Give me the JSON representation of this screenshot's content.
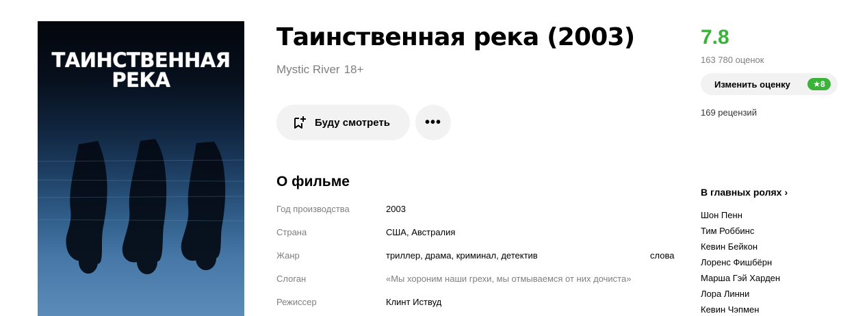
{
  "poster": {
    "title_line1": "ТАИНСТВЕННАЯ",
    "title_line2": "РЕКА"
  },
  "movie": {
    "title": "Таинственная река (2003)",
    "original_title": "Mystic River",
    "age_rating": "18+"
  },
  "actions": {
    "watch_later_label": "Буду смотреть",
    "more_label": "•••"
  },
  "about": {
    "heading": "О фильме",
    "rows": [
      {
        "label": "Год производства",
        "value": "2003"
      },
      {
        "label": "Страна",
        "value": "США, Австралия"
      },
      {
        "label": "Жанр",
        "value": "триллер, драма, криминал, детектив",
        "extra": "слова"
      },
      {
        "label": "Слоган",
        "value": "«Мы хороним наши грехи, мы отмываемся от них дочиста»"
      },
      {
        "label": "Режиссер",
        "value": "Клинт Иствуд"
      }
    ]
  },
  "rating": {
    "score": "7.8",
    "votes": "163 780 оценок",
    "change_label": "Изменить оценку",
    "my_score": "★8",
    "reviews": "169 рецензий",
    "score_color": "#3bb33b"
  },
  "cast": {
    "heading": "В главных ролях",
    "chevron": "›",
    "actors": [
      "Шон Пенн",
      "Тим Роббинс",
      "Кевин Бейкон",
      "Лоренс Фишбёрн",
      "Марша Гэй Харден",
      "Лора Линни",
      "Кевин Чэпмен"
    ]
  }
}
